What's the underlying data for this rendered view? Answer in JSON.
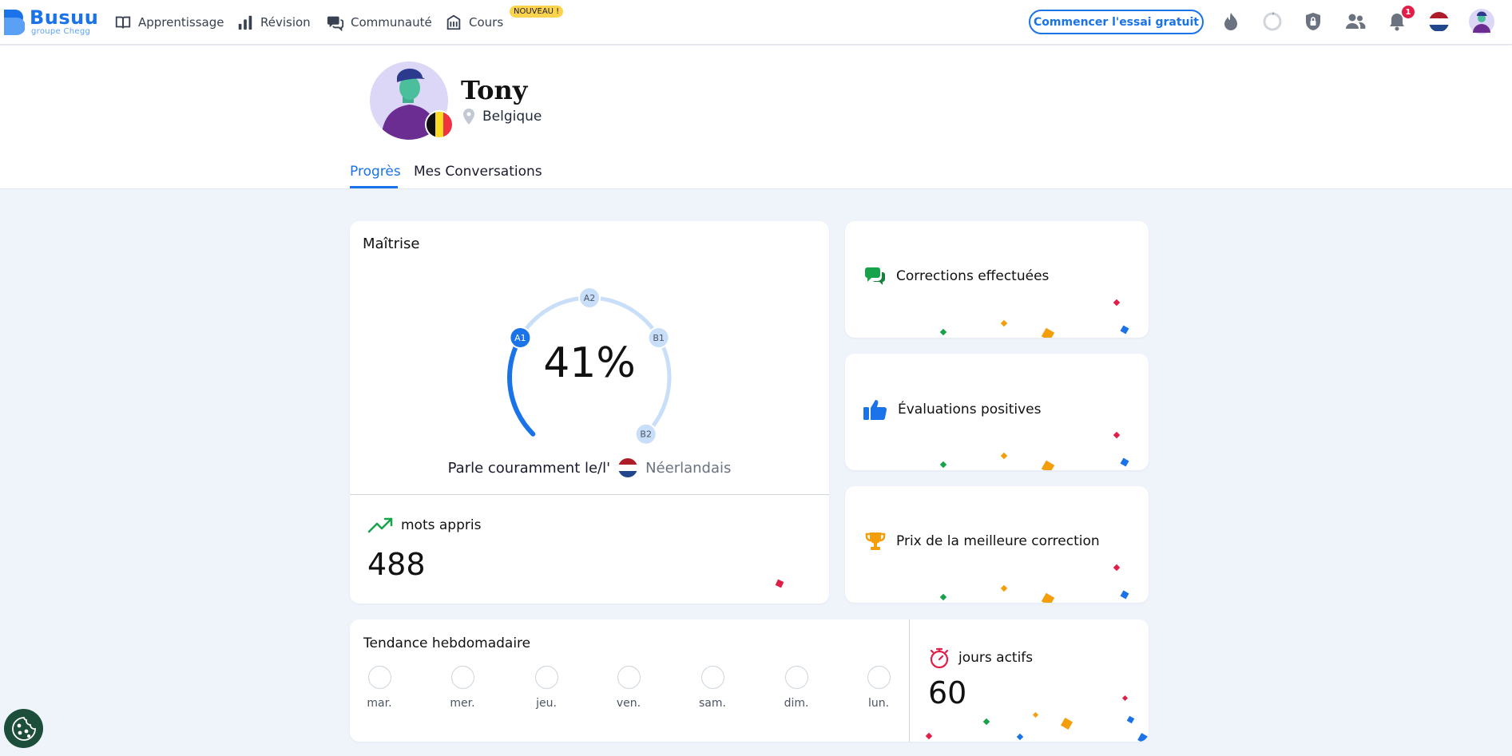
{
  "logo": {
    "wordmark": "Busuu",
    "subtitle": "groupe Chegg"
  },
  "nav": {
    "items": [
      {
        "label": "Apprentissage",
        "icon": "book-icon"
      },
      {
        "label": "Révision",
        "icon": "bar-chart-icon"
      },
      {
        "label": "Communauté",
        "icon": "chat-bubbles-icon"
      },
      {
        "label": "Cours",
        "icon": "building-icon"
      }
    ],
    "new_badge": "NOUVEAU !",
    "trial_button": "Commencer l'essai gratuit",
    "notifications_count": "1"
  },
  "profile": {
    "name": "Tony",
    "location": "Belgique",
    "tabs": [
      "Progrès",
      "Mes Conversations"
    ]
  },
  "mastery": {
    "title": "Maîtrise",
    "percent": "41%",
    "progress_fraction": 0.41,
    "levels": [
      "A1",
      "A2",
      "B1",
      "B2"
    ],
    "fluent_prefix": "Parle couramment le/l'",
    "language": "Néerlandais"
  },
  "words": {
    "label": "mots appris",
    "value": "488"
  },
  "side_cards": [
    {
      "label": "Corrections effectuées",
      "icon": "chat-icon"
    },
    {
      "label": "Évaluations positives",
      "icon": "thumbs-up-icon"
    },
    {
      "label": "Prix de la meilleure correction",
      "icon": "trophy-icon"
    }
  ],
  "weekly": {
    "title": "Tendance hebdomadaire",
    "days": [
      "mar.",
      "mer.",
      "jeu.",
      "ven.",
      "sam.",
      "dim.",
      "lun."
    ]
  },
  "active_days": {
    "label": "jours actifs",
    "value": "60"
  },
  "colors": {
    "brand_blue": "#1a73e8",
    "light_blue": "#c9def9",
    "new_badge": "#fcd34d",
    "notif_red": "#e11d48"
  }
}
